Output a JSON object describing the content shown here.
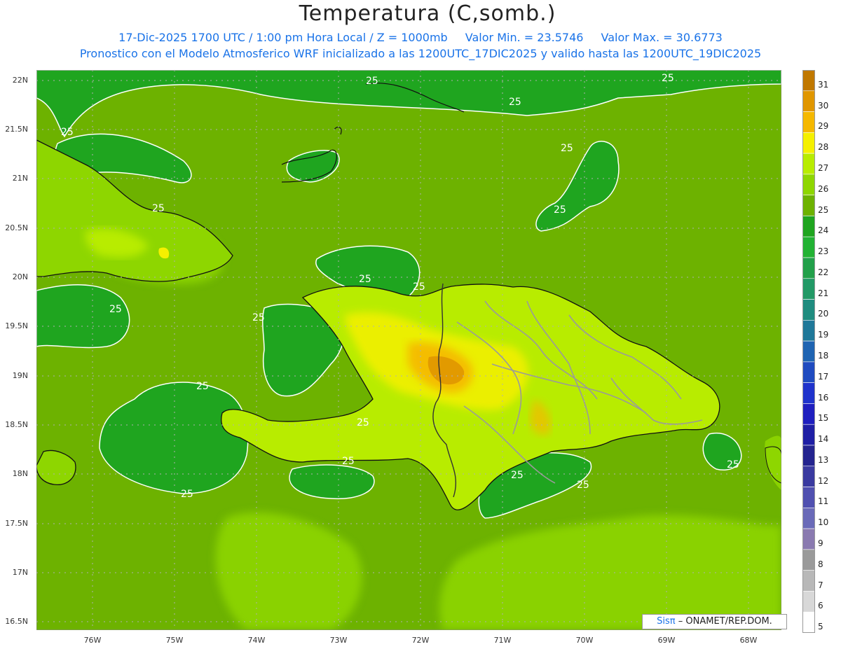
{
  "title": "Temperatura (C,somb.)",
  "subtitle_line1": {
    "date_time": "17-Dic-2025  1700 UTC / 1:00 pm Hora Local / Z = 1000mb",
    "min": "Valor Min. = 23.5746",
    "max": "Valor Max. = 30.6773"
  },
  "subtitle_line2": "Pronostico con el Modelo Atmosferico WRF inicializado a las 1200UTC_17DIC2025 y valido hasta las  1200UTC_19DIC2025",
  "axes": {
    "y_ticks": [
      "22N",
      "21.5N",
      "21N",
      "20.5N",
      "20N",
      "19.5N",
      "19N",
      "18.5N",
      "18N",
      "17.5N",
      "17N",
      "16.5N"
    ],
    "x_ticks": [
      "76W",
      "75W",
      "74W",
      "73W",
      "72W",
      "71W",
      "70W",
      "69W",
      "68W"
    ]
  },
  "contour_label": "25",
  "legend": {
    "levels": [
      "31",
      "30",
      "29",
      "28",
      "27",
      "26",
      "25",
      "24",
      "23",
      "22",
      "21",
      "20",
      "19",
      "18",
      "17",
      "16",
      "15",
      "14",
      "13",
      "12",
      "11",
      "10",
      "9",
      "8",
      "7",
      "6",
      "5"
    ],
    "colors": [
      "#c07800",
      "#e09600",
      "#f5b800",
      "#f5f000",
      "#b8ec00",
      "#8ed600",
      "#6db200",
      "#1fa51f",
      "#22b233",
      "#22a04a",
      "#229966",
      "#1f8c7f",
      "#1f7899",
      "#1f64b2",
      "#1f4bc0",
      "#1f33cc",
      "#1f1fbf",
      "#1f1fa5",
      "#24248f",
      "#3a3aa0",
      "#5050b0",
      "#6a6ab8",
      "#8a7ab0",
      "#9a9a9a",
      "#b8b8b8",
      "#d8d8d8",
      "#ffffff"
    ]
  },
  "credit": {
    "brand": "Sisπ",
    "text": "– ONAMET/REP.DOM."
  }
}
